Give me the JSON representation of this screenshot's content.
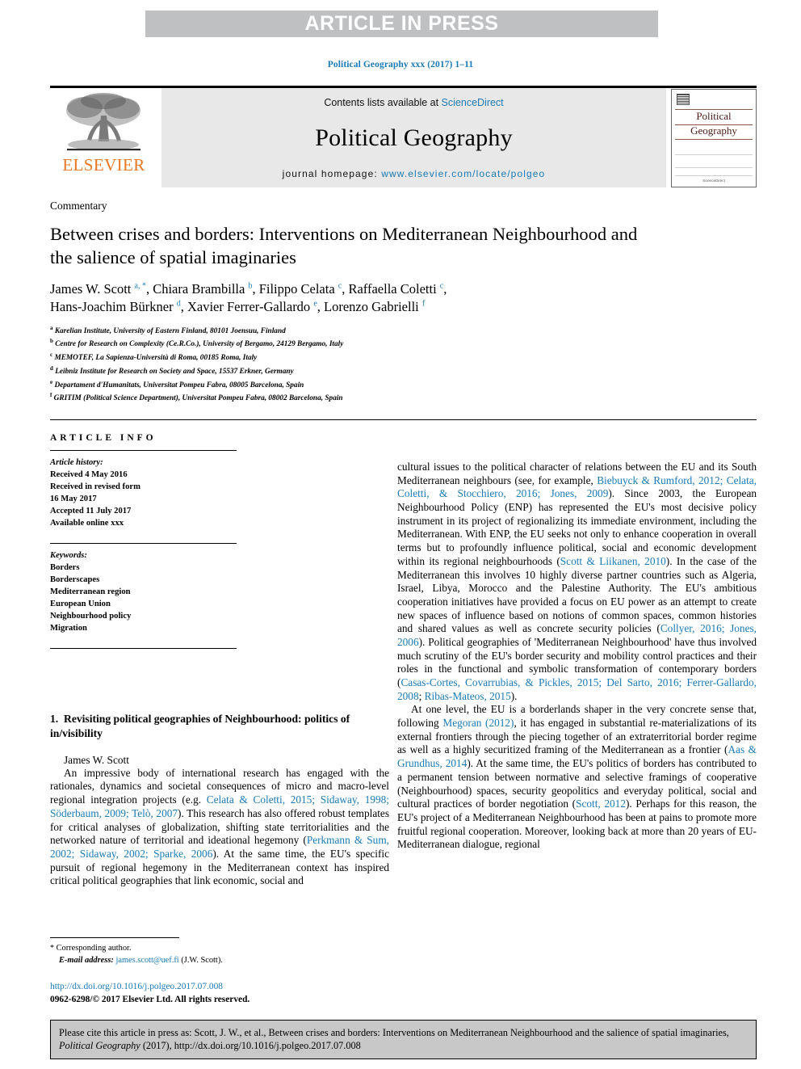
{
  "banner": {
    "text": "ARTICLE IN PRESS"
  },
  "running_head": {
    "text": "Political Geography xxx (2017) 1–11"
  },
  "masthead": {
    "publisher_name": "ELSEVIER",
    "contents_prefix": "Contents lists available at ",
    "contents_link": "ScienceDirect",
    "journal_name": "Political Geography",
    "homepage_prefix": "journal homepage: ",
    "homepage_url": "www.elsevier.com/locate/polgeo",
    "cover": {
      "title_line1": "Political",
      "title_line2": "Geography",
      "footer_mark": "ScienceDirect"
    }
  },
  "article": {
    "doc_type": "Commentary",
    "title": "Between crises and borders: Interventions on Mediterranean Neighbourhood and the salience of spatial imaginaries",
    "authors_line1_a": "James W. Scott ",
    "authors_sup1": "a, *",
    "authors_line1_b": ", Chiara Brambilla ",
    "authors_sup2": "b",
    "authors_line1_c": ", Filippo Celata ",
    "authors_sup3": "c",
    "authors_line1_d": ", Raffaella Coletti ",
    "authors_sup4": "c",
    "authors_line1_e": ",",
    "authors_line2_a": "Hans-Joachim Bürkner ",
    "authors_sup5": "d",
    "authors_line2_b": ", Xavier Ferrer-Gallardo ",
    "authors_sup6": "e",
    "authors_line2_c": ", Lorenzo Gabrielli ",
    "authors_sup7": "f",
    "affiliations": [
      {
        "mark": "a",
        "text": "Karelian Institute, University of Eastern Finland, 80101 Joensuu, Finland"
      },
      {
        "mark": "b",
        "text": "Centre for Research on Complexity (Ce.R.Co.), University of Bergamo, 24129 Bergamo, Italy"
      },
      {
        "mark": "c",
        "text": "MEMOTEF, La Sapienza-Università di Roma, 00185 Roma, Italy"
      },
      {
        "mark": "d",
        "text": "Leibniz Institute for Research on Society and Space, 15537 Erkner, Germany"
      },
      {
        "mark": "e",
        "text": "Departament d'Humanitats, Universitat Pompeu Fabra, 08005 Barcelona, Spain"
      },
      {
        "mark": "f",
        "text": "GRITIM (Political Science Department), Universitat Pompeu Fabra, 08002 Barcelona, Spain"
      }
    ]
  },
  "article_info": {
    "heading": "ARTICLE INFO",
    "history_label": "Article history:",
    "history": [
      "Received 4 May 2016",
      "Received in revised form",
      "16 May 2017",
      "Accepted 11 July 2017",
      "Available online xxx"
    ],
    "keywords_label": "Keywords:",
    "keywords": [
      "Borders",
      "Borderscapes",
      "Mediterranean region",
      "European Union",
      "Neighbourhood policy",
      "Migration"
    ]
  },
  "left_column": {
    "section_number": "1.",
    "section_title": "Revisiting political geographies of Neighbourhood: politics of in/visibility",
    "byline": "James W. Scott",
    "para1_pre": "An impressive body of international research has engaged with the rationales, dynamics and societal consequences of micro and macro-level regional integration projects (e.g. ",
    "para1_ref1": "Celata & Coletti, 2015; Sidaway, 1998; Söderbaum, 2009; Telò, 2007",
    "para1_mid": "). This research has also offered robust templates for critical analyses of globalization, shifting state territorialities and the networked nature of territorial and ideational hegemony (",
    "para1_ref2": "Perkmann & Sum, 2002; Sidaway, 2002; Sparke, 2006",
    "para1_post": "). At the same time, the EU's specific pursuit of regional hegemony in the Mediterranean context has inspired critical political geographies that link economic, social and"
  },
  "right_column": {
    "para_cont_pre": "cultural issues to the political character of relations between the EU and its South Mediterranean neighbours (see, for example, ",
    "para_cont_ref1": "Biebuyck & Rumford, 2012; Celata, Coletti, & Stocchiero, 2016; Jones, 2009",
    "para_cont_mid1": "). Since 2003, the European Neighbourhood Policy (ENP) has represented the EU's most decisive policy instrument in its project of regionalizing its immediate environment, including the Mediterranean. With ENP, the EU seeks not only to enhance cooperation in overall terms but to profoundly influence political, social and economic development within its regional neighbourhoods (",
    "para_cont_ref2": "Scott & Liikanen, 2010",
    "para_cont_mid2": "). In the case of the Mediterranean this involves 10 highly diverse partner countries such as Algeria, Israel, Libya, Morocco and the Palestine Authority. The EU's ambitious cooperation initiatives have provided a focus on EU power as an attempt to create new spaces of influence based on notions of common spaces, common histories and shared values as well as concrete security policies (",
    "para_cont_ref3": "Collyer, 2016; Jones, 2006",
    "para_cont_mid3": "). Political geographies of 'Mediterranean Neighbourhood' have thus involved much scrutiny of the EU's border security and mobility control practices and their roles in the functional and symbolic transformation of contemporary borders (",
    "para_cont_ref4": "Casas-Cortes, Covarrubias, & Pickles, 2015; Del Sarto, 2016; Ferrer-Gallardo, 2008",
    "para_cont_semi": "; ",
    "para_cont_ref5": "Ribas-Mateos, 2015",
    "para_cont_end": ").",
    "para2_pre": "At one level, the EU is a borderlands shaper in the very concrete sense that, following ",
    "para2_ref1": "Megoran (2012)",
    "para2_mid1": ", it has engaged in substantial re-materializations of its external frontiers through the piecing together of an extraterritorial border regime as well as a highly securitized framing of the Mediterranean as a frontier (",
    "para2_ref2": "Aas & Grundhus, 2014",
    "para2_mid2": "). At the same time, the EU's politics of borders has contributed to a permanent tension between normative and selective framings of cooperative (Neighbourhood) spaces, security geopolitics and everyday political, social and cultural practices of border negotiation (",
    "para2_ref3": "Scott, 2012",
    "para2_post": "). Perhaps for this reason, the EU's project of a Mediterranean Neighbourhood has been at pains to promote more fruitful regional cooperation. Moreover, looking back at more than 20 years of EU-Mediterranean dialogue, regional"
  },
  "footnote": {
    "star": "*",
    "corresponding": " Corresponding author.",
    "email_label": "E-mail address:",
    "email": "james.scott@uef.fi",
    "email_owner": "(J.W. Scott)."
  },
  "doi_block": {
    "doi_url": "http://dx.doi.org/10.1016/j.polgeo.2017.07.008",
    "copyright": "0962-6298/© 2017 Elsevier Ltd. All rights reserved."
  },
  "cite_footer": {
    "pre": "Please cite this article in press as: Scott, J. W., et al., Between crises and borders: Interventions on Mediterranean Neighbourhood and the salience of spatial imaginaries, ",
    "journal": "Political Geography",
    "post": " (2017), http://dx.doi.org/10.1016/j.polgeo.2017.07.008"
  },
  "colors": {
    "link_blue": "#1b7ab5",
    "elsevier_orange": "#e87722",
    "banner_grey": "#bfc0c2",
    "contents_grey": "#e8e8e8",
    "footer_grey": "#c8c8c8"
  }
}
